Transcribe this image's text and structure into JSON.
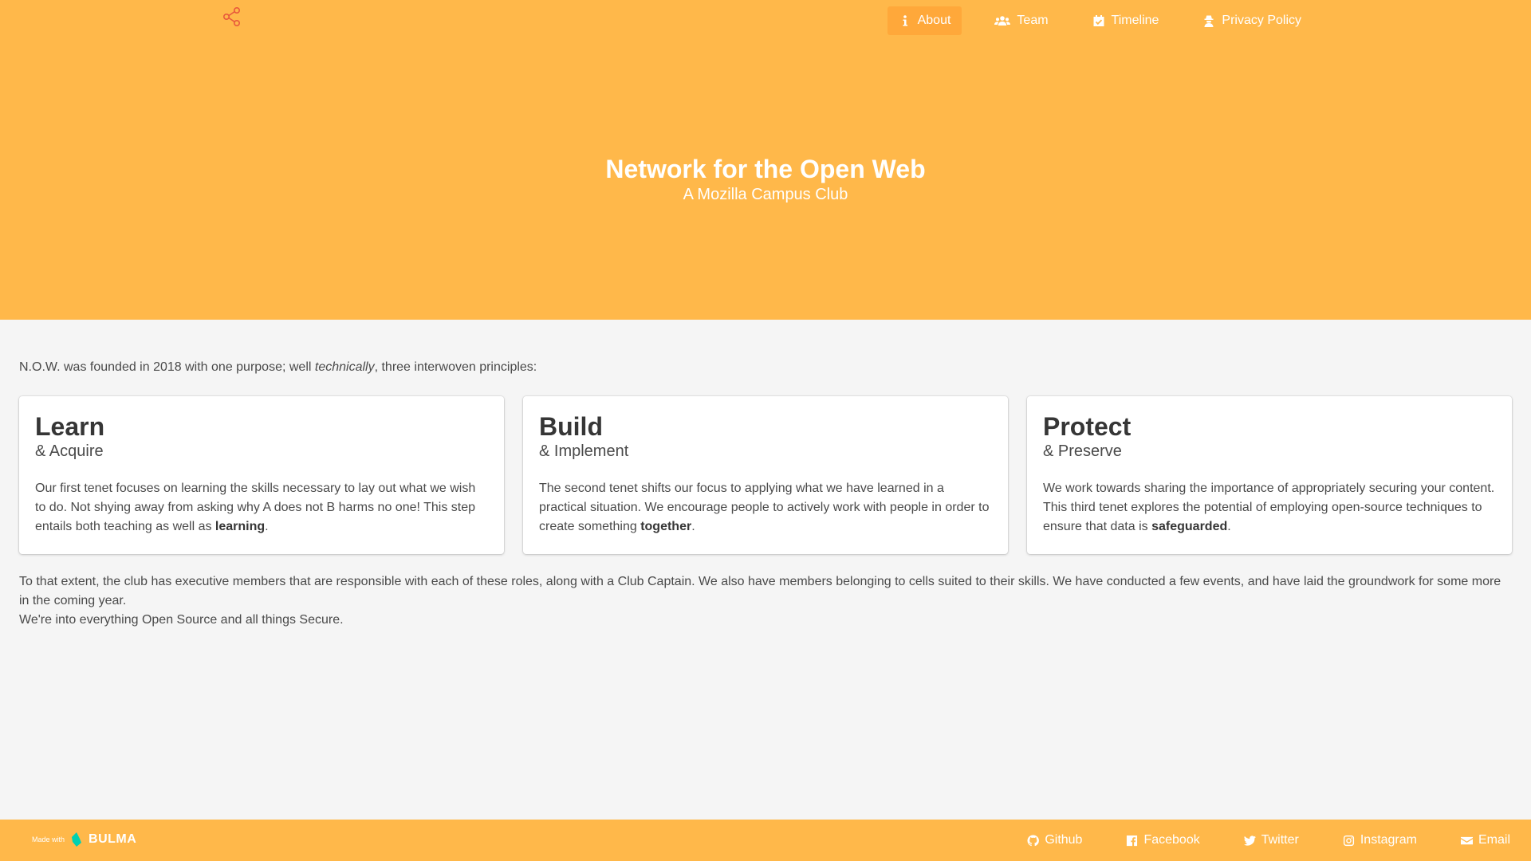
{
  "nav": {
    "items": [
      {
        "label": "About",
        "icon": "info-icon",
        "active": true
      },
      {
        "label": "Team",
        "icon": "users-icon"
      },
      {
        "label": "Timeline",
        "icon": "calendar-check-icon"
      },
      {
        "label": "Privacy Policy",
        "icon": "user-secret-icon"
      }
    ]
  },
  "hero": {
    "title": "Network for the Open Web",
    "subtitle": "A Mozilla Campus Club"
  },
  "intro": {
    "before": "N.O.W. was founded in 2018 with one purpose; well ",
    "emphasis": "technically",
    "after": ", three interwoven principles:"
  },
  "cards": [
    {
      "title": "Learn",
      "subtitle": "& Acquire",
      "text": "Our first tenet focuses on learning the skills necessary to lay out what we wish to do. Not shying away from asking why A does not B harms no one! This step entails both teaching as well as ",
      "bold": "learning",
      "end": "."
    },
    {
      "title": "Build",
      "subtitle": "& Implement",
      "text": "The second tenet shifts our focus to applying what we have learned in a practical situation. We encourage people to actively work with people in order to create something ",
      "bold": "together",
      "end": "."
    },
    {
      "title": "Protect",
      "subtitle": "& Preserve",
      "text": "We work towards sharing the importance of appropriately securing your content. This third tenet explores the potential of employing open-source techniques to ensure that data is ",
      "bold": "safeguarded",
      "end": "."
    }
  ],
  "outro": {
    "line1": "To that extent, the club has executive members that are responsible with each of these roles, along with a Club Captain. We also have members belonging to cells suited to their skills. We have conducted a few events, and have laid the groundwork for some more in the coming year.",
    "line2": "We're into everything Open Source and all things Secure."
  },
  "footer": {
    "made_with": "Made with",
    "brand": "BULMA",
    "links": [
      {
        "label": "Github",
        "icon": "github-icon"
      },
      {
        "label": "Facebook",
        "icon": "facebook-icon"
      },
      {
        "label": "Twitter",
        "icon": "twitter-icon"
      },
      {
        "label": "Instagram",
        "icon": "instagram-icon"
      },
      {
        "label": "Email",
        "icon": "envelope-icon"
      }
    ]
  },
  "colors": {
    "primary": "#ffb84a",
    "nav_active": "#ffa83a",
    "background": "#f5f5f5",
    "logo": "#e8593c",
    "bulma": "#00d1b2"
  }
}
